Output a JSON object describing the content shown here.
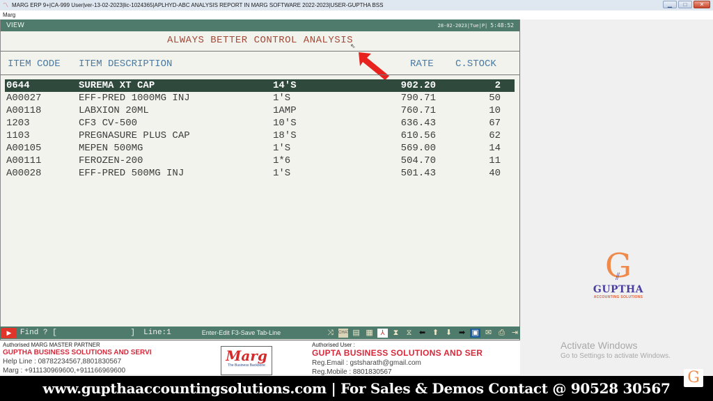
{
  "window": {
    "title": "MARG ERP 9+|CA-999 User|ver-13-02-2023|lic-1024365|APLHYD-ABC ANALYSIS REPORT IN MARG SOFTWARE 2022-2023|USER-GUPTHA BSS",
    "menu": "Marg",
    "controls": {
      "minimize": "▁",
      "maximize": "□",
      "close": "✕"
    }
  },
  "viewbar": {
    "label": "VIEW",
    "date": "28-02-2023|Tue|P|",
    "time": "5:48:52"
  },
  "report": {
    "title": "ALWAYS BETTER CONTROL ANALYSIS",
    "columns": {
      "item_code": "ITEM CODE",
      "item_description": "ITEM DESCRIPTION",
      "rate": "RATE",
      "c_stock": "C.STOCK"
    },
    "rows": [
      {
        "code": "0644",
        "description": "SUREMA XT CAP",
        "pack": "14'S",
        "rate": "902.20",
        "stock": "2",
        "selected": true
      },
      {
        "code": "A00027",
        "description": "EFF-PRED 1000MG INJ",
        "pack": "1'S",
        "rate": "790.71",
        "stock": "50"
      },
      {
        "code": "A00118",
        "description": "LABXION 20ML",
        "pack": "1AMP",
        "rate": "760.71",
        "stock": "10"
      },
      {
        "code": "1203",
        "description": "CF3 CV-500",
        "pack": "10'S",
        "rate": "636.43",
        "stock": "67"
      },
      {
        "code": "1103",
        "description": "PREGNASURE PLUS CAP",
        "pack": "18'S",
        "rate": "610.56",
        "stock": "62"
      },
      {
        "code": "A00105",
        "description": "MEPEN 500MG",
        "pack": "1'S",
        "rate": "569.00",
        "stock": "14"
      },
      {
        "code": "A00111",
        "description": "FEROZEN-200",
        "pack": "1*6",
        "rate": "504.70",
        "stock": "11"
      },
      {
        "code": "A00028",
        "description": "EFF-PRED 500MG INJ",
        "pack": "1'S",
        "rate": "501.43",
        "stock": "40"
      }
    ]
  },
  "findbar": {
    "find_label": "Find ? [                ]",
    "line_label": "Line:1",
    "hint": "Enter-Edit F3-Save Tab-Line",
    "icons": [
      "shuffle-icon",
      "chat-icon",
      "note-icon",
      "excel-icon",
      "pdf-icon",
      "top-icon",
      "bottom-icon",
      "left-arrow-icon",
      "up-arrow-icon",
      "down-arrow-icon",
      "right-arrow-icon",
      "save-icon",
      "mail-icon",
      "print-icon",
      "exit-icon"
    ]
  },
  "footer": {
    "partner_label": "Authorised MARG MASTER PARTNER",
    "partner_name": "GUPTHA BUSINESS SOLUTIONS AND SERVI",
    "helpline": "Help Line : 08782234567,8801830567",
    "marg_phone": "Marg : +911130969600,+911166969600",
    "marg_brand": "Marg",
    "marg_tagline": "The Business Backbone",
    "user_label": "Authorised User :",
    "user_name": "GUPTA BUSINESS SOLUTIONS AND SER",
    "reg_email": "Reg.Email : gstsharath@gmail.com",
    "reg_mobile": "Reg.Mobile : 8801830567"
  },
  "watermark": {
    "logo_letter": "G",
    "logo_name": "GUPTHA",
    "logo_sub": "ACCOUNTING SOLUTIONS",
    "activate_title": "Activate Windows",
    "activate_sub": "Go to Settings to activate Windows."
  },
  "banner": {
    "text": "www.gupthaaccountingsolutions.com | For Sales & Demos Contact @ 90528 30567"
  }
}
